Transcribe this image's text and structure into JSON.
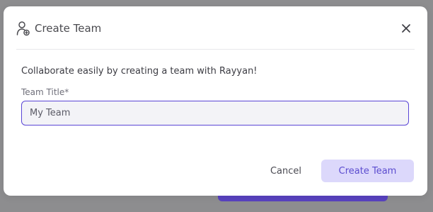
{
  "dialog": {
    "title": "Create Team",
    "title_icon": "user-add-icon",
    "close_icon": "close-icon",
    "intro_text": "Collaborate easily by creating a team with Rayyan!",
    "field": {
      "label": "Team Title*",
      "value": "My Team"
    },
    "actions": {
      "cancel_label": "Cancel",
      "create_label": "Create Team"
    }
  },
  "colors": {
    "accent": "#5a46d6",
    "primary_button_bg": "#dcd8fb",
    "primary_button_text": "#5b4ccf",
    "overlay": "#8d8d8f"
  }
}
